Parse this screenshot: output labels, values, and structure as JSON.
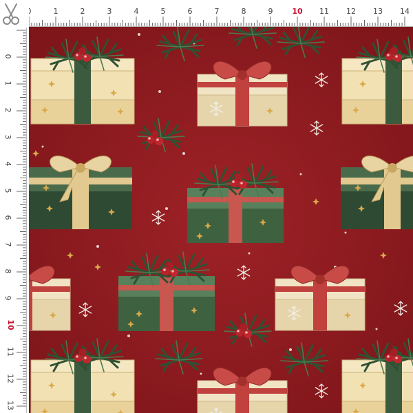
{
  "ruler": {
    "top_labels": [
      "0",
      "1",
      "2",
      "3",
      "4",
      "5",
      "6",
      "7",
      "8",
      "9",
      "10",
      "11",
      "12",
      "13",
      "14"
    ],
    "left_labels": [
      "0",
      "1",
      "2",
      "3",
      "4",
      "5",
      "6",
      "7",
      "8",
      "9",
      "10",
      "11",
      "12",
      "13"
    ],
    "accent_label": "10"
  },
  "colors": {
    "background": "#8e1a1f",
    "accent": "#c8102e",
    "gift_cream": "#efdcaa",
    "gift_green": "#3d5a3f",
    "ribbon_red": "#c0413e",
    "ribbon_gold": "#e2c98f"
  },
  "icons": [
    "scissors-icon",
    "snowflake-icon",
    "pine-branch-icon",
    "holly-berry-icon",
    "ribbon-bow-icon"
  ]
}
